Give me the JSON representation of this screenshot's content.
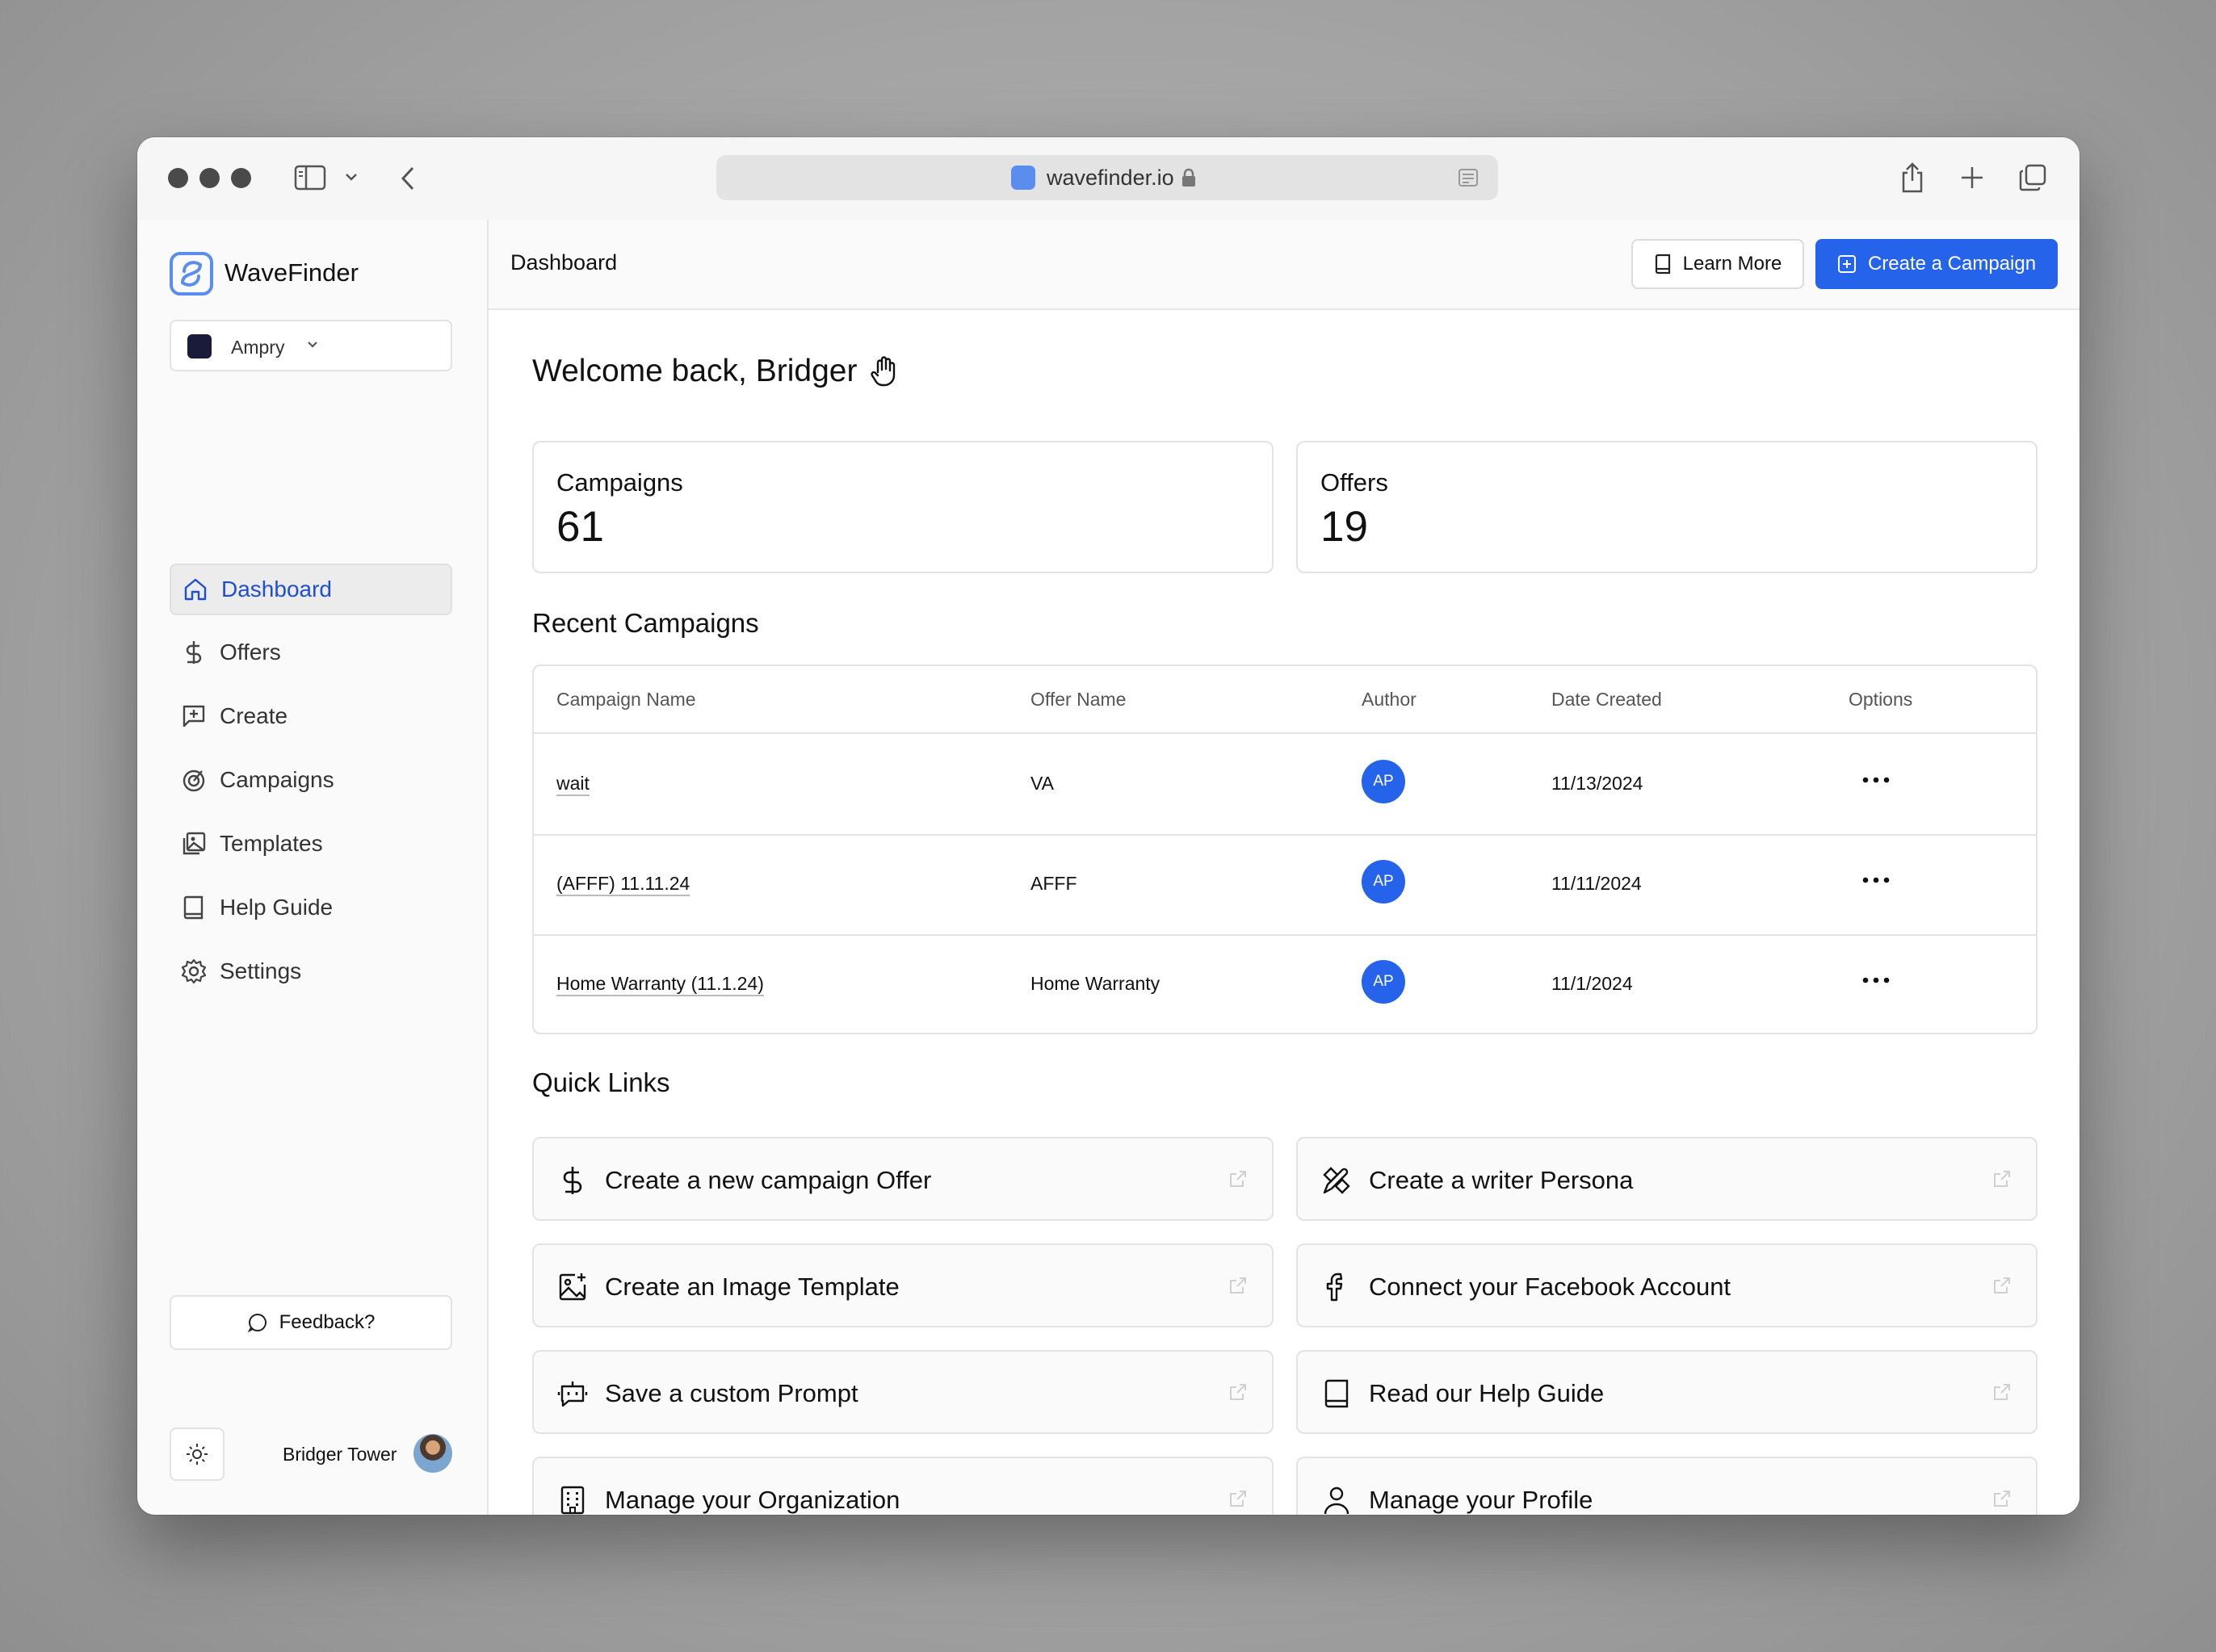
{
  "browser": {
    "url": "wavefinder.io"
  },
  "app": {
    "name": "WaveFinder",
    "org": "Ampry"
  },
  "sidebar": {
    "items": [
      {
        "label": "Dashboard"
      },
      {
        "label": "Offers"
      },
      {
        "label": "Create"
      },
      {
        "label": "Campaigns"
      },
      {
        "label": "Templates"
      },
      {
        "label": "Help Guide"
      },
      {
        "label": "Settings"
      }
    ],
    "feedback_label": "Feedback?",
    "user_name": "Bridger Tower"
  },
  "header": {
    "title": "Dashboard",
    "learn_more_label": "Learn More",
    "create_label": "Create a Campaign"
  },
  "main": {
    "welcome": "Welcome back, Bridger",
    "stats": [
      {
        "label": "Campaigns",
        "value": "61"
      },
      {
        "label": "Offers",
        "value": "19"
      }
    ],
    "recent_title": "Recent Campaigns",
    "table": {
      "columns": [
        "Campaign Name",
        "Offer Name",
        "Author",
        "Date Created",
        "Options"
      ],
      "rows": [
        {
          "campaign": "wait",
          "offer": "VA",
          "author": "AP",
          "date": "11/13/2024"
        },
        {
          "campaign": "(AFFF) 11.11.24",
          "offer": "AFFF",
          "author": "AP",
          "date": "11/11/2024"
        },
        {
          "campaign": "Home Warranty (11.1.24)",
          "offer": "Home Warranty",
          "author": "AP",
          "date": "11/1/2024"
        }
      ]
    },
    "quick_title": "Quick Links",
    "quick_links": [
      {
        "label": "Create a new campaign Offer",
        "icon": "dollar-icon"
      },
      {
        "label": "Create a writer Persona",
        "icon": "pen-ruler-icon"
      },
      {
        "label": "Create an Image Template",
        "icon": "image-plus-icon"
      },
      {
        "label": "Connect your Facebook Account",
        "icon": "facebook-icon"
      },
      {
        "label": "Save a custom Prompt",
        "icon": "bot-message-icon"
      },
      {
        "label": "Read our Help Guide",
        "icon": "book-icon"
      },
      {
        "label": "Manage your Organization",
        "icon": "building-icon"
      },
      {
        "label": "Manage your Profile",
        "icon": "user-icon"
      }
    ]
  },
  "colors": {
    "accent": "#2563eb",
    "active_nav_text": "#1f4fd1"
  }
}
